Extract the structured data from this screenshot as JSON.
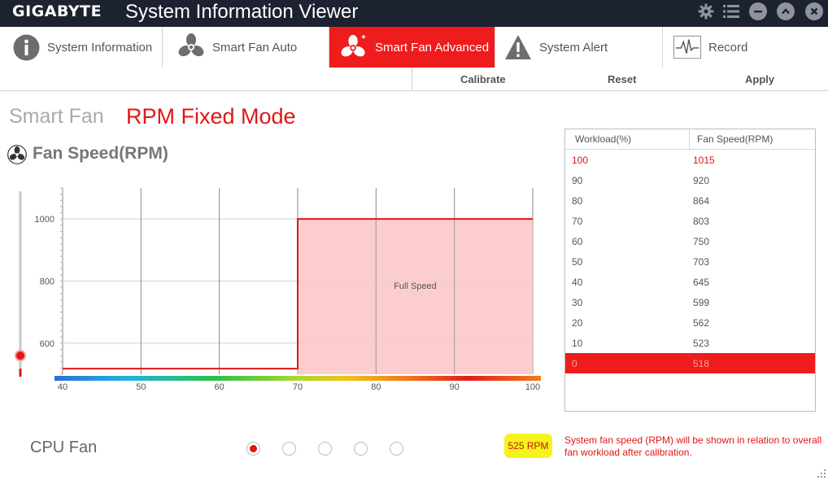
{
  "app": {
    "brand": "GIGABYTE",
    "title": "System Information Viewer"
  },
  "window_controls": [
    "gear-icon",
    "list-icon",
    "minimize-icon",
    "collapse-icon",
    "close-icon"
  ],
  "tabs": [
    {
      "label": "System Information",
      "icon": "info-icon",
      "active": false
    },
    {
      "label": "Smart Fan Auto",
      "icon": "fan-icon",
      "active": false
    },
    {
      "label": "Smart Fan Advanced",
      "icon": "fan-plus-icon",
      "active": true
    },
    {
      "label": "System Alert",
      "icon": "warning-icon",
      "active": false
    },
    {
      "label": "Record",
      "icon": "heartbeat-icon",
      "active": false
    }
  ],
  "actions": {
    "calibrate": "Calibrate",
    "reset": "Reset",
    "apply": "Apply"
  },
  "mode": {
    "label": "Smart Fan",
    "value": "RPM Fixed Mode"
  },
  "section_title": "Fan Speed(RPM)",
  "chart_data": {
    "type": "line",
    "xlabel": "",
    "ylabel": "",
    "x_ticks": [
      40,
      50,
      60,
      70,
      80,
      90,
      100
    ],
    "y_ticks": [
      600,
      800,
      1000
    ],
    "xlim": [
      40,
      100
    ],
    "ylim": [
      500,
      1100
    ],
    "series": [
      {
        "x": [
          40,
          70,
          70,
          100
        ],
        "y": [
          518,
          518,
          1000,
          1000
        ]
      }
    ],
    "annotations": [
      {
        "text": "Full Speed",
        "x": 85,
        "y": 775
      }
    ],
    "shaded_region": {
      "x_from": 70,
      "x_to": 100,
      "y_to": 1000
    },
    "slider_value_rpm": 518,
    "accent": "#e01616"
  },
  "table": {
    "headers": [
      "Workload(%)",
      "Fan Speed(RPM)"
    ],
    "rows": [
      {
        "workload": "100",
        "rpm": "1015"
      },
      {
        "workload": "90",
        "rpm": "920"
      },
      {
        "workload": "80",
        "rpm": "864"
      },
      {
        "workload": "70",
        "rpm": "803"
      },
      {
        "workload": "60",
        "rpm": "750"
      },
      {
        "workload": "50",
        "rpm": "703"
      },
      {
        "workload": "40",
        "rpm": "645"
      },
      {
        "workload": "30",
        "rpm": "599"
      },
      {
        "workload": "20",
        "rpm": "562"
      },
      {
        "workload": "10",
        "rpm": "523"
      },
      {
        "workload": "0",
        "rpm": "518"
      }
    ],
    "highlighted_row": 0,
    "selected_row": 10
  },
  "fan": {
    "name": "CPU Fan",
    "current_rpm": "525 RPM",
    "selector_count": 5,
    "selected_index": 0
  },
  "note": "System fan speed (RPM) will be shown in relation to overall fan workload after calibration."
}
